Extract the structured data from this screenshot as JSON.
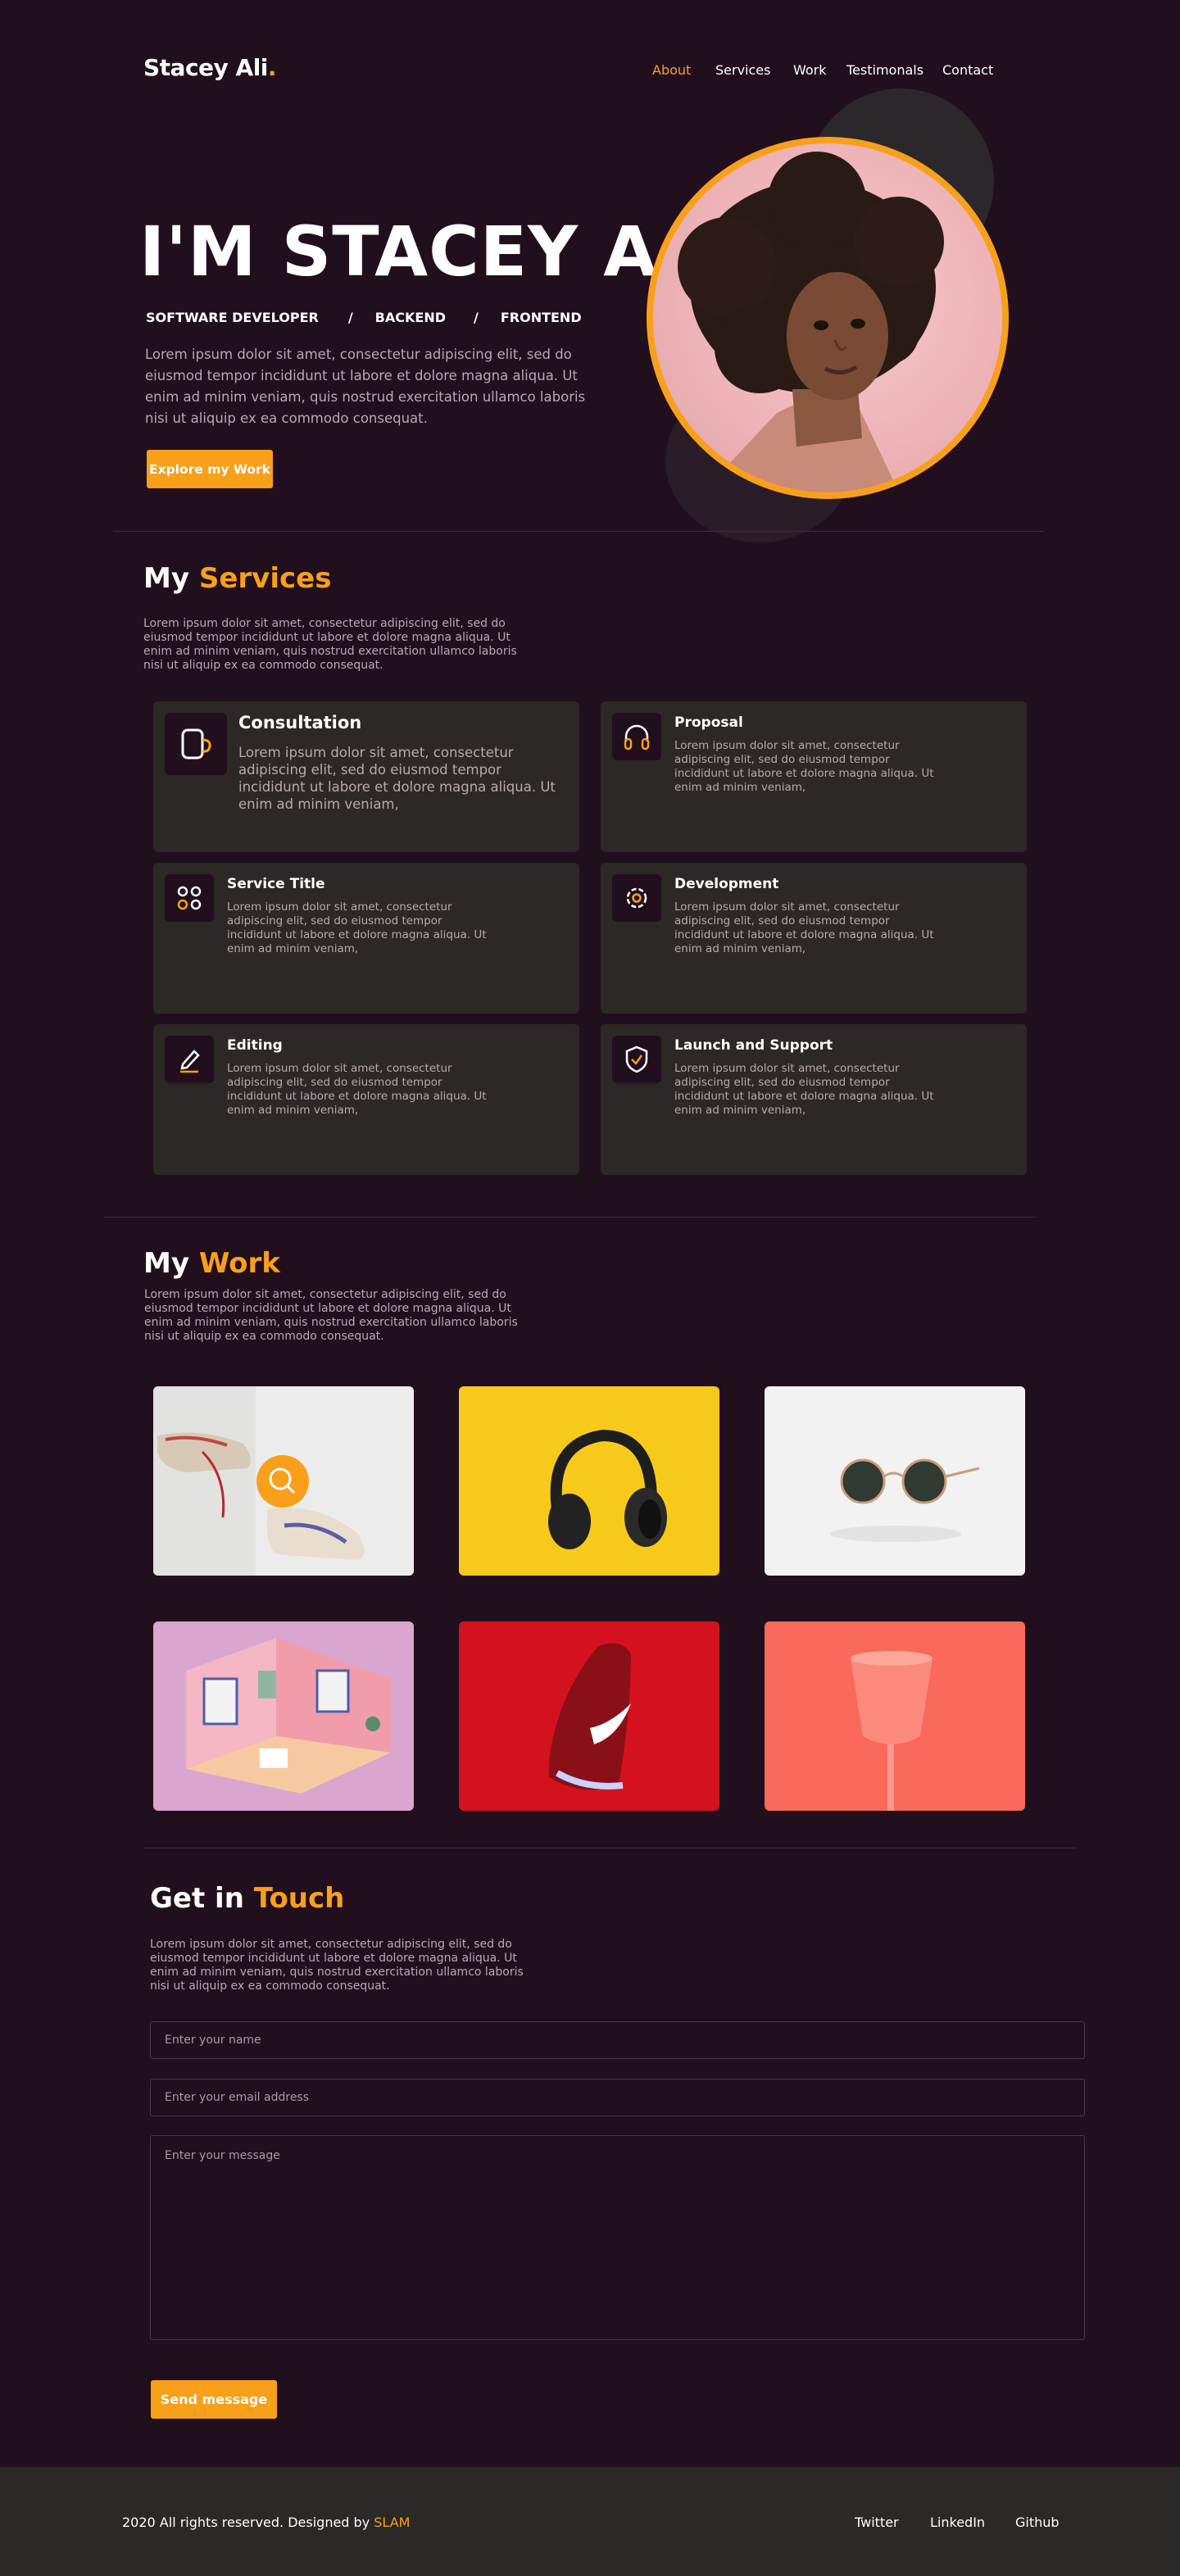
{
  "header": {
    "logo": "Stacey Ali",
    "logo_dot": ".",
    "nav": [
      "About",
      "Services",
      "Work",
      "Testimonals",
      "Contact"
    ],
    "active_nav": "About",
    "accent_color": "#f9a01b",
    "background_color": "#220f1d"
  },
  "hero": {
    "title": "I'M STACEY  A.",
    "roles": [
      "SOFTWARE DEVELOPER",
      "/",
      "BACKEND",
      "/",
      "FRONTEND"
    ],
    "text": "Lorem ipsum dolor sit amet, consectetur adipiscing elit, sed do eiusmod tempor incididunt ut labore et dolore magna aliqua. Ut enim ad minim veniam, quis nostrud exercitation ullamco laboris nisi ut aliquip ex ea commodo consequat.",
    "button": "Explore my Work"
  },
  "services": {
    "title_prefix": "My",
    "title_accent": "Services",
    "text": "Lorem ipsum dolor sit amet, consectetur adipiscing elit, sed do eiusmod tempor incididunt ut labore et dolore magna aliqua. Ut enim ad minim veniam, quis nostrud exercitation ullamco laboris nisi ut aliquip ex ea commodo consequat.",
    "items": [
      {
        "title": "Consultation",
        "icon": "mug-icon",
        "text": "Lorem ipsum dolor sit amet, consectetur adipiscing elit, sed do eiusmod tempor incididunt ut labore et dolore magna aliqua. Ut enim ad minim veniam,"
      },
      {
        "title": "Proposal",
        "icon": "headphones-icon",
        "text": "Lorem ipsum dolor sit amet, consectetur adipiscing elit, sed do eiusmod tempor incididunt ut labore et dolore magna aliqua. Ut enim ad minim veniam,"
      },
      {
        "title": "Service Title",
        "icon": "grid-dots-icon",
        "text": "Lorem ipsum dolor sit amet, consectetur adipiscing elit, sed do eiusmod tempor incididunt ut labore et dolore magna aliqua. Ut enim ad minim veniam,"
      },
      {
        "title": "Development",
        "icon": "gear-icon",
        "text": "Lorem ipsum dolor sit amet, consectetur adipiscing elit, sed do eiusmod tempor incididunt ut labore et dolore magna aliqua. Ut enim ad minim veniam,"
      },
      {
        "title": "Editing",
        "icon": "pencil-icon",
        "text": "Lorem ipsum dolor sit amet, consectetur adipiscing elit, sed do eiusmod tempor incididunt ut labore et dolore magna aliqua. Ut enim ad minim veniam,"
      },
      {
        "title": "Launch and Support",
        "icon": "shield-check-icon",
        "text": "Lorem ipsum dolor sit amet, consectetur adipiscing elit, sed do eiusmod tempor incididunt ut labore et dolore magna aliqua. Ut enim ad minim veniam,"
      }
    ]
  },
  "work": {
    "title_prefix": "My",
    "title_accent": "Work",
    "text": "Lorem ipsum dolor sit amet, consectetur adipiscing elit, sed do eiusmod tempor incididunt ut labore et dolore magna aliqua. Ut enim ad minim veniam, quis nostrud exercitation ullamco laboris nisi ut aliquip ex ea commodo consequat.",
    "items": [
      "sneakers",
      "headphones",
      "sunglasses",
      "isometric-room",
      "red-sneaker",
      "pink-glass"
    ]
  },
  "contact": {
    "title_prefix": "Get in",
    "title_accent": "Touch",
    "text": "Lorem ipsum dolor sit amet, consectetur adipiscing elit, sed do eiusmod tempor incididunt ut labore et dolore magna aliqua. Ut enim ad minim veniam, quis nostrud exercitation ullamco laboris nisi ut aliquip ex ea commodo consequat.",
    "name_placeholder": "Enter your name",
    "email_placeholder": "Enter your email address",
    "message_placeholder": "Enter your message",
    "button": "Send message"
  },
  "footer": {
    "copyright": "2020 All rights reserved. Designed by",
    "designer": "SLAM",
    "links": [
      "Twitter",
      "LinkedIn",
      "Github"
    ]
  }
}
